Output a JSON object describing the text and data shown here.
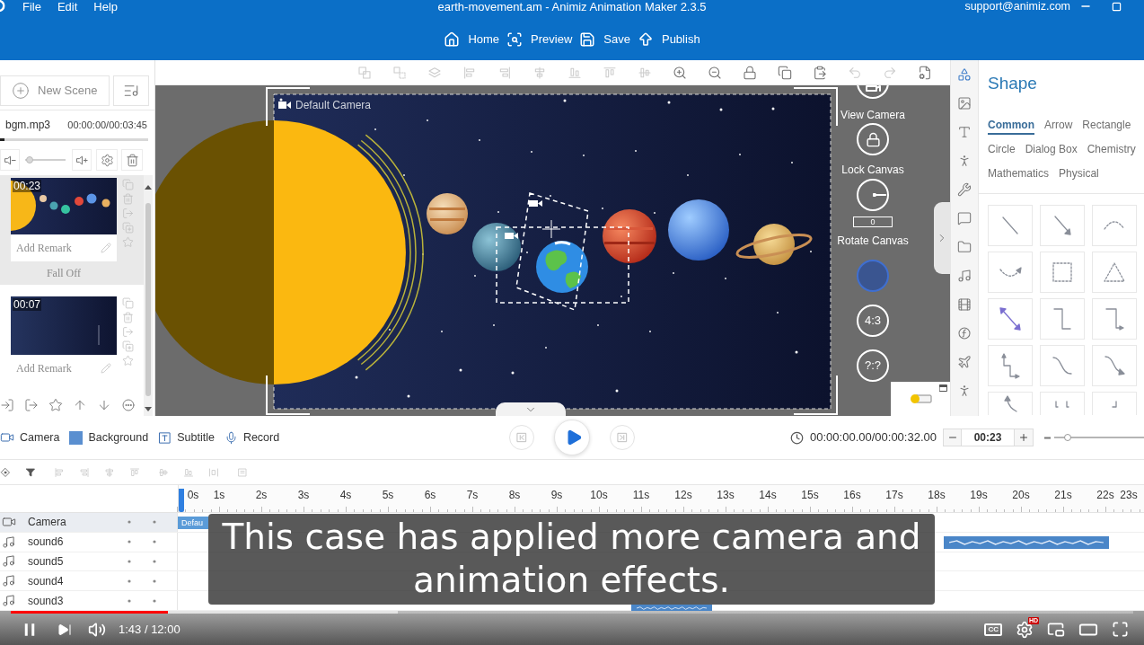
{
  "title_bar": {
    "menu": [
      "File",
      "Edit",
      "Help"
    ],
    "title": "earth-movement.am - Animiz Animation Maker 2.3.5",
    "account": "support@animiz.com"
  },
  "main_toolbar": [
    {
      "kind": "home",
      "label": "Home"
    },
    {
      "kind": "preview",
      "label": "Preview"
    },
    {
      "kind": "save",
      "label": "Save"
    },
    {
      "kind": "publish",
      "label": "Publish"
    }
  ],
  "scene_panel": {
    "new_scene": "New Scene",
    "music": {
      "file": "bgm.mp3",
      "time": "00:00:00/00:03:45",
      "level": 0.03
    },
    "volume": {
      "level": 0.1
    },
    "scenes": [
      {
        "kind": "planets",
        "duration": "00:23",
        "placeholder": "Add Remark",
        "selected": true,
        "transition": "Fall Off"
      },
      {
        "kind": "dark",
        "duration": "00:07",
        "placeholder": "Add Remark",
        "selected": false
      }
    ]
  },
  "canvas_toolbar": [
    {
      "kind": "group",
      "disabled": true
    },
    {
      "kind": "ungroup",
      "disabled": true
    },
    {
      "kind": "stack",
      "disabled": true
    },
    {
      "kind": "left",
      "disabled": true
    },
    {
      "kind": "right",
      "disabled": true
    },
    {
      "kind": "center",
      "disabled": true
    },
    {
      "kind": "bottom",
      "disabled": true
    },
    {
      "kind": "top",
      "disabled": true
    },
    {
      "kind": "middle",
      "disabled": true
    },
    {
      "kind": "zoomin",
      "disabled": false
    },
    {
      "kind": "zoomout",
      "disabled": false
    },
    {
      "kind": "lock",
      "disabled": false
    },
    {
      "kind": "copy",
      "disabled": false
    },
    {
      "kind": "paste",
      "disabled": false
    },
    {
      "kind": "undo",
      "disabled": true
    },
    {
      "kind": "redo",
      "disabled": true
    },
    {
      "kind": "properties",
      "disabled": false
    }
  ],
  "canvas": {
    "camera_label": "Default Camera",
    "controls": [
      {
        "kind": "view",
        "label": "View Camera"
      },
      {
        "kind": "lock",
        "label": "Lock Canvas"
      },
      {
        "kind": "rotate",
        "label": "Rotate Canvas",
        "value": "0"
      },
      {
        "kind": "ratio",
        "selected": true
      },
      {
        "kind": "ratio",
        "text": "4:3",
        "selected": false
      },
      {
        "kind": "ratio",
        "text": "?:?",
        "selected": false
      }
    ]
  },
  "right_rail": [
    {
      "kind": "shape",
      "selected": true
    },
    {
      "kind": "image",
      "selected": false
    },
    {
      "kind": "text",
      "selected": false
    },
    {
      "kind": "character",
      "selected": false
    },
    {
      "kind": "tools",
      "selected": false
    },
    {
      "kind": "speech",
      "selected": false
    },
    {
      "kind": "folder",
      "selected": false
    },
    {
      "kind": "music",
      "selected": false
    },
    {
      "kind": "video",
      "selected": false
    },
    {
      "kind": "formula",
      "selected": false
    },
    {
      "kind": "plane",
      "selected": false
    },
    {
      "kind": "figure",
      "selected": false
    }
  ],
  "shape_panel": {
    "title": "Shape",
    "tabs": [
      {
        "label": "Common",
        "selected": true
      },
      {
        "label": "Arrow",
        "selected": false
      },
      {
        "label": "Rectangle",
        "selected": false
      },
      {
        "label": "Circle",
        "selected": false
      },
      {
        "label": "Dialog Box",
        "selected": false
      },
      {
        "label": "Chemistry",
        "selected": false
      },
      {
        "label": "Mathematics",
        "selected": false
      },
      {
        "label": "Physical",
        "selected": false
      }
    ],
    "shapes": [
      {
        "kind": "line"
      },
      {
        "kind": "arrow"
      },
      {
        "kind": "arc"
      },
      {
        "kind": "curve"
      },
      {
        "kind": "rectangle"
      },
      {
        "kind": "triangle"
      },
      {
        "kind": "doublearrow"
      },
      {
        "kind": "elbow"
      },
      {
        "kind": "elbowarrow"
      },
      {
        "kind": "connector"
      },
      {
        "kind": "wave"
      },
      {
        "kind": "wavearrow"
      },
      {
        "kind": "hook"
      },
      {
        "kind": "bracket"
      },
      {
        "kind": "corner"
      }
    ]
  },
  "add_bar": [
    {
      "kind": "camera",
      "label": "Camera"
    },
    {
      "kind": "background",
      "label": "Background"
    },
    {
      "kind": "subtitle",
      "label": "Subtitle"
    },
    {
      "kind": "record",
      "label": "Record"
    }
  ],
  "playback": {
    "playing": false,
    "time": "00:00:00.00/00:00:32.00",
    "duration": "00:23",
    "zoom": {
      "level": 0.15
    }
  },
  "timeline_toolbar": [
    {
      "kind": "keyframe",
      "disabled": false
    },
    {
      "kind": "filter",
      "disabled": false
    },
    {
      "kind": "left",
      "disabled": true
    },
    {
      "kind": "right",
      "disabled": true
    },
    {
      "kind": "center",
      "disabled": true
    },
    {
      "kind": "top",
      "disabled": true
    },
    {
      "kind": "middle",
      "disabled": true
    },
    {
      "kind": "bottom",
      "disabled": true
    },
    {
      "kind": "distribute",
      "disabled": true
    },
    {
      "kind": "frame",
      "disabled": true
    }
  ],
  "ruler": [
    "0s",
    "1s",
    "2s",
    "3s",
    "4s",
    "5s",
    "6s",
    "7s",
    "8s",
    "9s",
    "10s",
    "11s",
    "12s",
    "13s",
    "14s",
    "15s",
    "16s",
    "17s",
    "18s",
    "19s",
    "20s",
    "21s",
    "22s",
    "23s"
  ],
  "tracks": [
    {
      "kind": "camera",
      "name": "Camera",
      "selected": true,
      "clips": [
        {
          "kind": "camera",
          "label": "Defau"
        }
      ]
    },
    {
      "kind": "sound",
      "name": "sound6",
      "selected": false,
      "clips": [
        {
          "kind": "audio"
        }
      ]
    },
    {
      "kind": "sound",
      "name": "sound5",
      "selected": false
    },
    {
      "kind": "sound",
      "name": "sound4",
      "selected": false
    },
    {
      "kind": "sound",
      "name": "sound3",
      "selected": false,
      "clips": [
        {
          "kind": "audio"
        }
      ]
    }
  ],
  "caption": {
    "text": "This case has applied more camera and animation effects."
  },
  "player": {
    "playing": true,
    "level": 0.14,
    "buffer": {
      "level": 0.345
    },
    "time": "1:43 / 12:00",
    "captions": "CC",
    "quality": "HD"
  }
}
